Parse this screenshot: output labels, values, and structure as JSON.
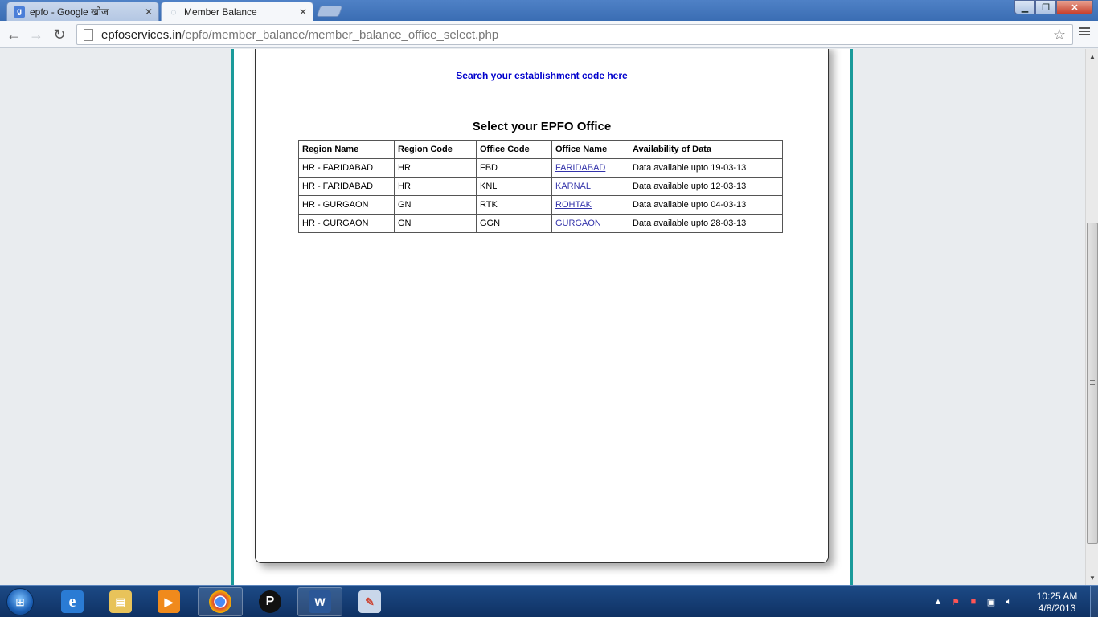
{
  "browser": {
    "tabs": [
      {
        "label": "epfo - Google खोज",
        "icon": "google-icon",
        "active": false
      },
      {
        "label": "Member Balance",
        "icon": "loading-icon",
        "active": true
      }
    ],
    "url_host": "epfoservices.in",
    "url_path": "/epfo/member_balance/member_balance_office_select.php"
  },
  "page": {
    "search_link": "Search your establishment code here",
    "heading": "Select your EPFO Office",
    "table": {
      "headers": [
        "Region Name",
        "Region Code",
        "Office Code",
        "Office Name",
        "Availability of Data"
      ],
      "rows": [
        [
          "HR - FARIDABAD",
          "HR",
          "FBD",
          "FARIDABAD",
          "Data available upto 19-03-13"
        ],
        [
          "HR - FARIDABAD",
          "HR",
          "KNL",
          "KARNAL",
          "Data available upto 12-03-13"
        ],
        [
          "HR - GURGAON",
          "GN",
          "RTK",
          "ROHTAK",
          "Data available upto 04-03-13"
        ],
        [
          "HR - GURGAON",
          "GN",
          "GGN",
          "GURGAON",
          "Data available upto 28-03-13"
        ]
      ]
    }
  },
  "taskbar": {
    "apps": [
      "internet-explorer-icon",
      "file-explorer-icon",
      "media-player-icon",
      "chrome-icon",
      "p3g-app-icon",
      "word-icon",
      "paint-icon"
    ],
    "clock_time": "10:25 AM",
    "clock_date": "4/8/2013"
  },
  "colors": {
    "accent_teal": "#1a9a9a",
    "link": "#0000cc",
    "taskbar": "#1c4a86"
  }
}
